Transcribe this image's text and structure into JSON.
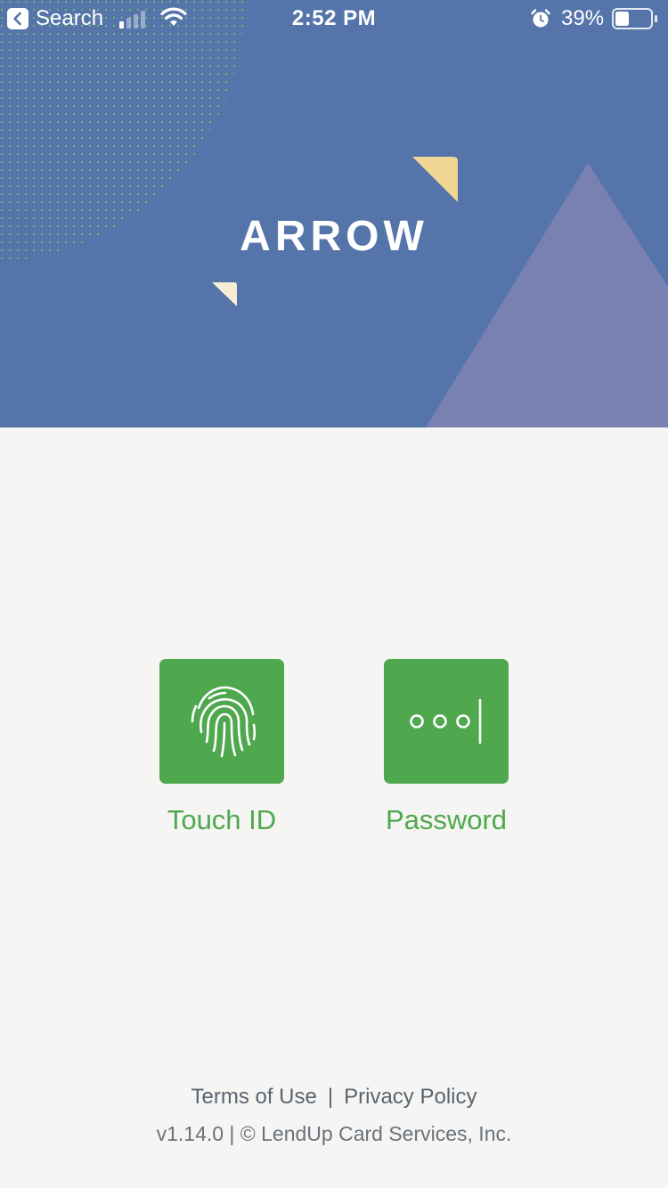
{
  "status_bar": {
    "back_label": "Search",
    "time": "2:52 PM",
    "battery_percent": "39%",
    "battery_level": 0.39,
    "icons": [
      "back-arrow-icon",
      "cellular-signal-icon",
      "wifi-icon",
      "alarm-icon",
      "battery-icon"
    ]
  },
  "header": {
    "logo_text": "ARROW"
  },
  "auth_options": [
    {
      "label": "Touch ID",
      "icon": "fingerprint-icon"
    },
    {
      "label": "Password",
      "icon": "password-dots-icon"
    }
  ],
  "footer": {
    "terms_label": "Terms of Use",
    "separator": "|",
    "privacy_label": "Privacy Policy",
    "version_text": "v1.14.0 | © LendUp Card Services, Inc."
  },
  "colors": {
    "hero_background": "#5474aa",
    "triangle": "#7981b2",
    "accent_yellow": "#efd694",
    "accent_cream": "#f7eed5",
    "dots": "#6fb26c",
    "brand_green": "#4fa84e",
    "page_background": "#f5f5f3",
    "footer_text": "#5b6470"
  }
}
